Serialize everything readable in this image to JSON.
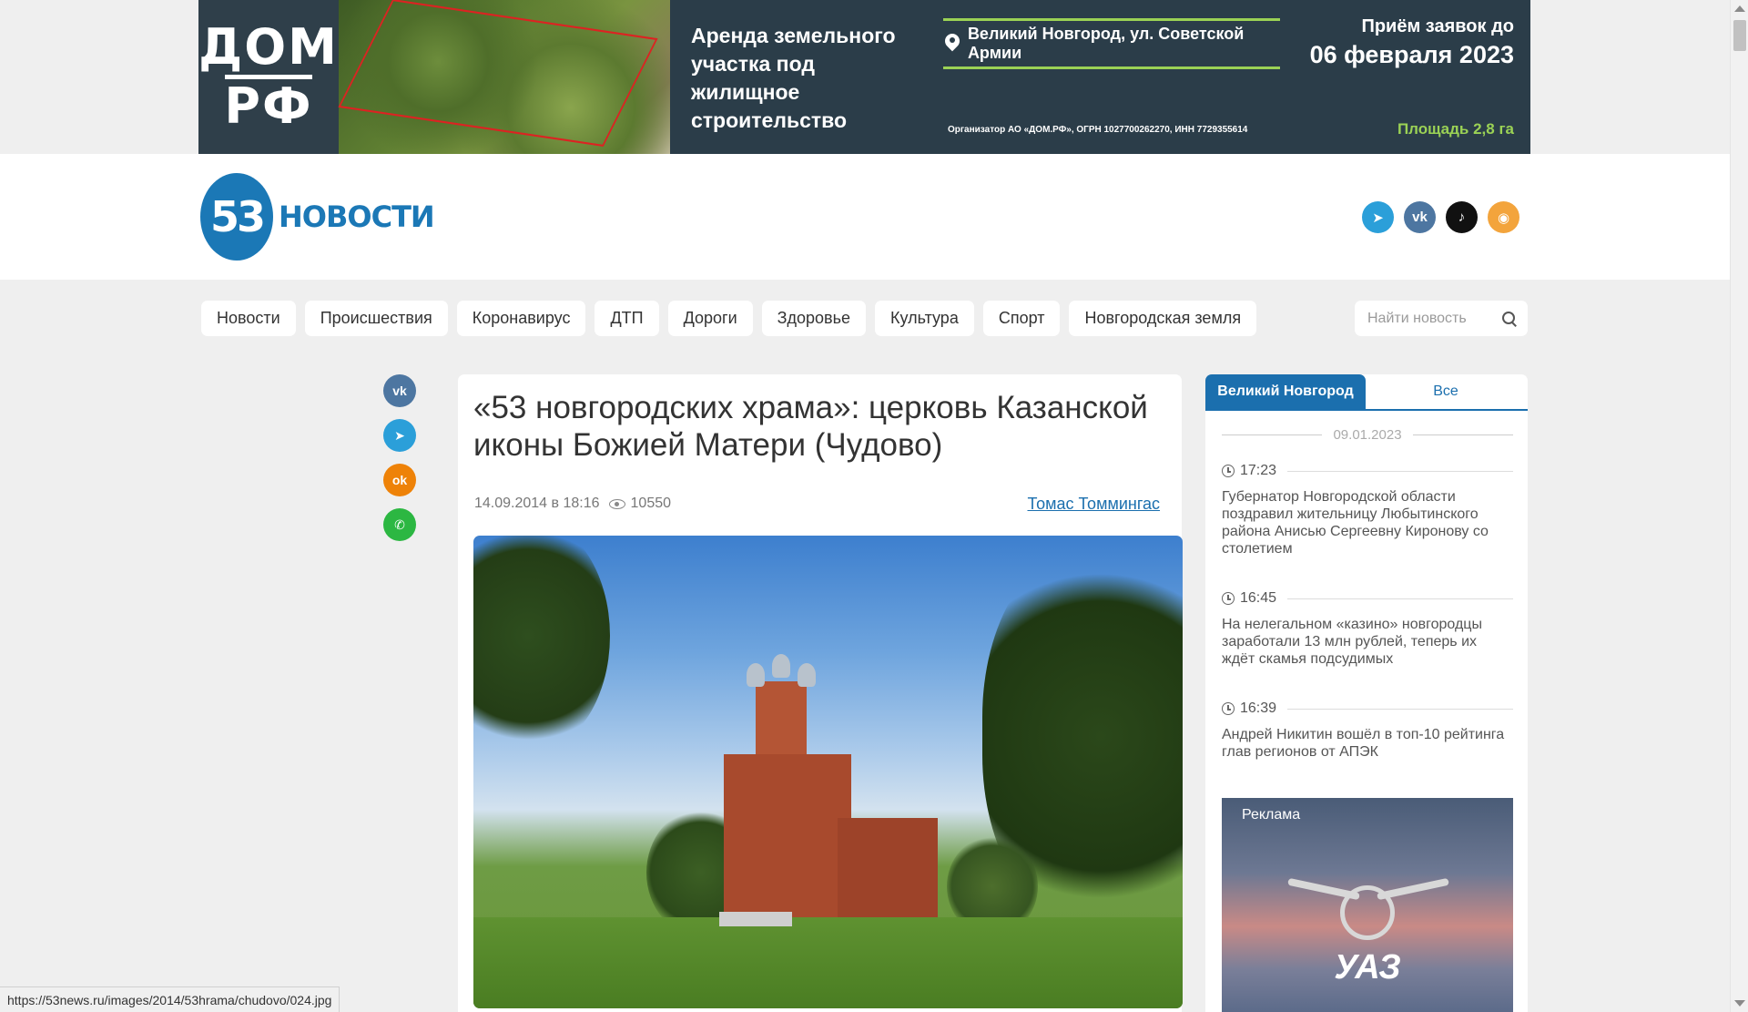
{
  "banner": {
    "logo_line1": "ДОМ",
    "logo_line2": "РФ",
    "title": "Аренда земельного участка под жилищное строительство",
    "address": "Великий Новгород, ул. Советской Армии",
    "organizer": "Организатор АО «ДОМ.РФ», ОГРН 1027700262270, ИНН 7729355614",
    "deadline_label": "Приём заявок до",
    "deadline_date": "06 февраля 2023",
    "area": "Площадь 2,8 га"
  },
  "site": {
    "logo_number": "53",
    "logo_name": "НОВОСТИ"
  },
  "social_icons": [
    "telegram-icon",
    "vk-icon",
    "tiktok-icon",
    "rss-icon"
  ],
  "nav": {
    "items": [
      "Новости",
      "Происшествия",
      "Коронавирус",
      "ДТП",
      "Дороги",
      "Здоровье",
      "Культура",
      "Спорт",
      "Новгородская земля"
    ],
    "search_placeholder": "Найти новость"
  },
  "share_icons": [
    "vk-icon",
    "telegram-icon",
    "odnoklassniki-icon",
    "whatsapp-icon"
  ],
  "article": {
    "title": "«53 новгородских храма»: церковь Казанской иконы Божией Матери (Чудово)",
    "date": "14.09.2014 в 18:16",
    "views": "10550",
    "author": "Томас Томмингас"
  },
  "sidebar": {
    "tab_active": "Великий Новгород",
    "tab_inactive": "Все",
    "date": "09.01.2023",
    "news": [
      {
        "time": "17:23",
        "title": "Губернатор Новгородской области поздравил жительницу Любытинского района Анисью Сергеевну Киронову со столетием"
      },
      {
        "time": "16:45",
        "title": "На нелегальном «казино» новгородцы заработали 13 млн рублей, теперь их ждёт скамья подсудимых"
      },
      {
        "time": "16:39",
        "title": "Андрей Никитин вошёл в топ-10 рейтинга глав регионов от АПЭК"
      }
    ],
    "ad_label": "Реклама",
    "ad_brand": "УАЗ"
  },
  "status_url": "https://53news.ru/images/2014/53hrama/chudovo/024.jpg",
  "colors": {
    "brand_blue": "#1b6fae",
    "banner_bg": "#2b3d49",
    "banner_accent": "#9bd255"
  }
}
